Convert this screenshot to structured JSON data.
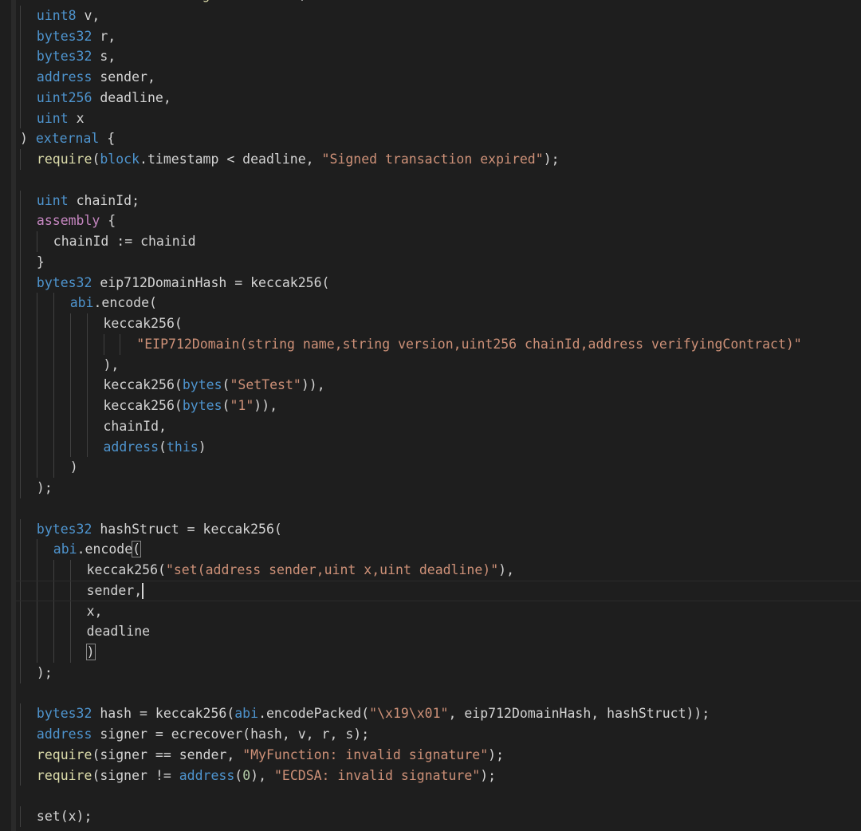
{
  "theme": {
    "background": "#1e1e1e",
    "keyword": "#c586c0",
    "type": "#4e94ce",
    "function": "#dcdcaa",
    "string": "#ce9178",
    "number": "#b5cea8",
    "identifier": "#9cdcfe",
    "plain": "#d4d4d4"
  },
  "editor": {
    "lines": [
      {
        "indent": 0,
        "tokens": [
          [
            "type",
            "function "
          ],
          [
            "fn",
            "executeSetIfSignatureMatch"
          ],
          [
            "plain",
            "("
          ]
        ]
      },
      {
        "indent": 1,
        "tokens": [
          [
            "type",
            "uint8"
          ],
          [
            "plain",
            " v,"
          ]
        ]
      },
      {
        "indent": 1,
        "tokens": [
          [
            "type",
            "bytes32"
          ],
          [
            "plain",
            " r,"
          ]
        ]
      },
      {
        "indent": 1,
        "tokens": [
          [
            "type",
            "bytes32"
          ],
          [
            "plain",
            " s,"
          ]
        ]
      },
      {
        "indent": 1,
        "tokens": [
          [
            "type",
            "address"
          ],
          [
            "plain",
            " sender,"
          ]
        ]
      },
      {
        "indent": 1,
        "tokens": [
          [
            "type",
            "uint256"
          ],
          [
            "plain",
            " deadline,"
          ]
        ]
      },
      {
        "indent": 1,
        "tokens": [
          [
            "type",
            "uint"
          ],
          [
            "plain",
            " x"
          ]
        ]
      },
      {
        "indent": 0,
        "tokens": [
          [
            "plain",
            ") "
          ],
          [
            "type",
            "external"
          ],
          [
            "plain",
            " {"
          ]
        ]
      },
      {
        "indent": 1,
        "tokens": [
          [
            "fn",
            "require"
          ],
          [
            "plain",
            "("
          ],
          [
            "type",
            "block"
          ],
          [
            "plain",
            ".timestamp < deadline, "
          ],
          [
            "str",
            "\"Signed transaction expired\""
          ],
          [
            "plain",
            ");"
          ]
        ]
      },
      {
        "indent": 0,
        "tokens": []
      },
      {
        "indent": 1,
        "tokens": [
          [
            "type",
            "uint"
          ],
          [
            "plain",
            " chainId;"
          ]
        ]
      },
      {
        "indent": 1,
        "tokens": [
          [
            "kw",
            "assembly"
          ],
          [
            "plain",
            " {"
          ]
        ]
      },
      {
        "indent": 2,
        "tokens": [
          [
            "plain",
            "chainId := chainid"
          ]
        ]
      },
      {
        "indent": 1,
        "tokens": [
          [
            "plain",
            "}"
          ]
        ]
      },
      {
        "indent": 1,
        "tokens": [
          [
            "type",
            "bytes32"
          ],
          [
            "plain",
            " eip712DomainHash = keccak256("
          ]
        ]
      },
      {
        "indent": 3,
        "tokens": [
          [
            "type",
            "abi"
          ],
          [
            "plain",
            ".encode("
          ]
        ]
      },
      {
        "indent": 5,
        "tokens": [
          [
            "plain",
            "keccak256("
          ]
        ]
      },
      {
        "indent": 7,
        "tokens": [
          [
            "str",
            "\"EIP712Domain(string name,string version,uint256 chainId,address verifyingContract)\""
          ]
        ]
      },
      {
        "indent": 5,
        "tokens": [
          [
            "plain",
            "),"
          ]
        ]
      },
      {
        "indent": 5,
        "tokens": [
          [
            "plain",
            "keccak256("
          ],
          [
            "type",
            "bytes"
          ],
          [
            "plain",
            "("
          ],
          [
            "str",
            "\"SetTest\""
          ],
          [
            "plain",
            ")),"
          ]
        ]
      },
      {
        "indent": 5,
        "tokens": [
          [
            "plain",
            "keccak256("
          ],
          [
            "type",
            "bytes"
          ],
          [
            "plain",
            "("
          ],
          [
            "str",
            "\"1\""
          ],
          [
            "plain",
            ")),"
          ]
        ]
      },
      {
        "indent": 5,
        "tokens": [
          [
            "plain",
            "chainId,"
          ]
        ]
      },
      {
        "indent": 5,
        "tokens": [
          [
            "type",
            "address"
          ],
          [
            "plain",
            "("
          ],
          [
            "type",
            "this"
          ],
          [
            "plain",
            ")"
          ]
        ]
      },
      {
        "indent": 3,
        "tokens": [
          [
            "plain",
            ")"
          ]
        ]
      },
      {
        "indent": 1,
        "tokens": [
          [
            "plain",
            ");"
          ]
        ]
      },
      {
        "indent": 0,
        "tokens": []
      },
      {
        "indent": 1,
        "tokens": [
          [
            "type",
            "bytes32"
          ],
          [
            "plain",
            " hashStruct = keccak256("
          ]
        ]
      },
      {
        "indent": 2,
        "tokens": [
          [
            "type",
            "abi"
          ],
          [
            "plain",
            ".encode"
          ],
          [
            "match",
            "("
          ]
        ]
      },
      {
        "indent": 4,
        "tokens": [
          [
            "plain",
            "keccak256("
          ],
          [
            "str",
            "\"set(address sender,uint x,uint deadline)\""
          ],
          [
            "plain",
            "),"
          ]
        ]
      },
      {
        "indent": 4,
        "current": true,
        "tokens": [
          [
            "plain",
            "sender,"
          ],
          [
            "cursor",
            ""
          ]
        ]
      },
      {
        "indent": 4,
        "tokens": [
          [
            "plain",
            "x,"
          ]
        ]
      },
      {
        "indent": 4,
        "tokens": [
          [
            "plain",
            "deadline"
          ]
        ]
      },
      {
        "indent": 4,
        "tokens": [
          [
            "match",
            ")"
          ]
        ]
      },
      {
        "indent": 1,
        "tokens": [
          [
            "plain",
            ");"
          ]
        ]
      },
      {
        "indent": 0,
        "tokens": []
      },
      {
        "indent": 1,
        "tokens": [
          [
            "type",
            "bytes32"
          ],
          [
            "plain",
            " hash = keccak256("
          ],
          [
            "type",
            "abi"
          ],
          [
            "plain",
            ".encodePacked("
          ],
          [
            "str",
            "\"\\x19\\x01\""
          ],
          [
            "plain",
            ", eip712DomainHash, hashStruct));"
          ]
        ]
      },
      {
        "indent": 1,
        "tokens": [
          [
            "type",
            "address"
          ],
          [
            "plain",
            " signer = ecrecover(hash, v, r, s);"
          ]
        ]
      },
      {
        "indent": 1,
        "tokens": [
          [
            "fn",
            "require"
          ],
          [
            "plain",
            "(signer == sender, "
          ],
          [
            "str",
            "\"MyFunction: invalid signature\""
          ],
          [
            "plain",
            ");"
          ]
        ]
      },
      {
        "indent": 1,
        "tokens": [
          [
            "fn",
            "require"
          ],
          [
            "plain",
            "(signer != "
          ],
          [
            "type",
            "address"
          ],
          [
            "plain",
            "("
          ],
          [
            "num",
            "0"
          ],
          [
            "plain",
            "), "
          ],
          [
            "str",
            "\"ECDSA: invalid signature\""
          ],
          [
            "plain",
            ");"
          ]
        ]
      },
      {
        "indent": 0,
        "tokens": []
      },
      {
        "indent": 1,
        "tokens": [
          [
            "plain",
            "set(x);"
          ]
        ]
      }
    ]
  }
}
